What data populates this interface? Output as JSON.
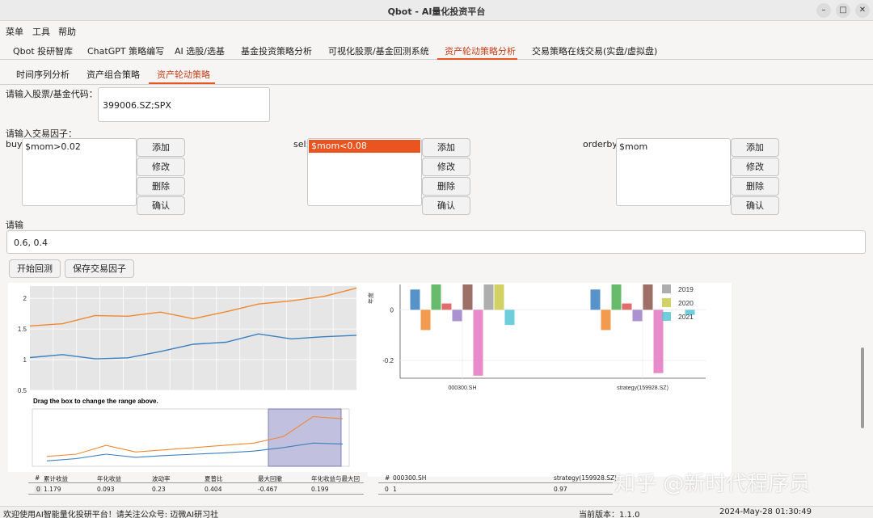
{
  "window": {
    "title": "Qbot - AI量化投资平台",
    "minimize_glyph": "–",
    "maximize_glyph": "□",
    "close_glyph": "✕"
  },
  "menubar": {
    "items": [
      "菜单",
      "工具",
      "帮助"
    ]
  },
  "main_tabs": [
    "Qbot 投研智库",
    "ChatGPT 策略编写",
    "AI 选股/选基",
    "基金投资策略分析",
    "可视化股票/基金回测系统",
    "资产轮动策略分析",
    "交易策略在线交易(实盘/虚拟盘)"
  ],
  "active_main_tab": 5,
  "sub_tabs": [
    "时间序列分析",
    "资产组合策略",
    "资产轮动策略"
  ],
  "active_sub_tab": 2,
  "form": {
    "code_label": "请输入股票/基金代码：",
    "code_value": "399006.SZ;SPX",
    "factor_label": "请输入交易因子：",
    "buy_label": "buy:",
    "buy_value": "$mom>0.02",
    "sell_label": "sel:",
    "sell_value": "$mom<0.08",
    "orderby_label": "orderby:",
    "orderby_value": "$mom",
    "buttons": [
      "添加",
      "修改",
      "删除",
      "确认"
    ],
    "weight_label": "请输",
    "weight_value": "0.6, 0.4",
    "run_button": "开始回测",
    "save_button": "保存交易因子"
  },
  "line_chart": {
    "y_ticks": [
      "2",
      "1.5",
      "1",
      "0.5"
    ],
    "range_caption": "Drag the box to change the range above.",
    "colors": {
      "strategy": "#f0882e",
      "benchmark": "#3a7fbf"
    }
  },
  "chart_data": [
    {
      "type": "line",
      "title": "",
      "ylim": [
        0.5,
        2.2
      ],
      "series": [
        {
          "values": [
            1.55,
            1.6,
            1.7,
            1.72,
            1.78,
            1.65,
            1.8,
            1.9,
            1.95,
            2.05,
            2.15
          ]
        },
        {
          "values": [
            1.05,
            1.08,
            1.0,
            1.05,
            1.12,
            1.25,
            1.3,
            1.4,
            1.35,
            1.38,
            1.38
          ]
        }
      ],
      "range_selector": {
        "caption": "Drag the box to change the range above.",
        "series": [
          {
            "values": [
              1.0,
              1.05,
              1.25,
              1.1,
              1.15,
              1.2,
              1.25,
              1.3,
              1.45,
              1.9,
              1.85
            ]
          },
          {
            "values": [
              0.9,
              0.95,
              1.05,
              0.98,
              1.02,
              1.05,
              1.08,
              1.12,
              1.2,
              1.3,
              1.28
            ]
          }
        ]
      }
    },
    {
      "type": "bar",
      "title": "",
      "ylabel": "年度",
      "categories": [
        "000300.SH",
        "strategy(159928.SZ)"
      ],
      "y_ticks": [
        "0",
        "-0.2"
      ],
      "ylim": [
        -0.27,
        0.1
      ],
      "legend": [
        "2019",
        "2020",
        "2021"
      ],
      "legend_colors": [
        "#a0a0a0",
        "#c9c94a",
        "#55c6d6"
      ],
      "series": [
        {
          "color": "#3a7fbf",
          "values": [
            0.08,
            0.08
          ]
        },
        {
          "color": "#f0882e",
          "values": [
            -0.08,
            -0.08
          ]
        },
        {
          "color": "#4caf50",
          "values": [
            0.1,
            0.1
          ]
        },
        {
          "color": "#d9534f",
          "values": [
            0.025,
            0.025
          ]
        },
        {
          "color": "#9b7ec8",
          "values": [
            -0.045,
            -0.045
          ]
        },
        {
          "color": "#8c564b",
          "values": [
            0.1,
            0.1
          ]
        },
        {
          "color": "#e377c2",
          "values": [
            -0.26,
            -0.25
          ]
        },
        {
          "color": "#a0a0a0",
          "values": [
            0.1,
            0.0
          ]
        },
        {
          "color": "#c9c94a",
          "values": [
            0.1,
            0.0
          ]
        },
        {
          "color": "#55c6d6",
          "values": [
            -0.06,
            -0.02
          ]
        }
      ]
    }
  ],
  "stats_left": {
    "headers": [
      "#",
      "累计收益",
      "年化收益",
      "波动率",
      "夏普比",
      "最大回撤",
      "年化收益与最大回"
    ],
    "row": [
      "0",
      "1.179",
      "0.093",
      "0.23",
      "0.404",
      "-0.467",
      "0.199"
    ]
  },
  "stats_right": {
    "headers": [
      "#",
      "000300.SH",
      "strategy(159928.SZ)"
    ],
    "row": [
      "0",
      "1",
      "0.97"
    ]
  },
  "watermark": "知乎 @新时代程序员",
  "statusbar": {
    "left": "欢迎使用AI智能量化投研平台！请关注公众号: 迈微AI研习社",
    "version": "当前版本：1.1.0",
    "datetime": "2024-May-28 01:30:49"
  }
}
